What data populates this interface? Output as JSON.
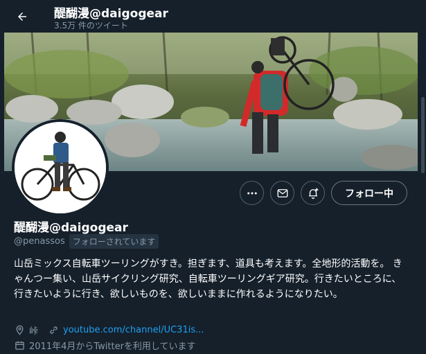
{
  "header": {
    "title": "醍醐漫@daigogear",
    "subtitle": "3.5万 件のツイート"
  },
  "profile": {
    "display_name": "醍醐漫@daigogear",
    "handle": "@penassos",
    "follows_you_badge": "フォローされています",
    "bio": "山岳ミックス自転車ツーリングがすき。担ぎます、道具も考えます。全地形的活動を。 きゃんつー集い、山岳サイクリング研究、自転車ツーリングギア研究。行きたいところに、行きたいように行き、欲しいものを、欲しいままに作れるようになりたい。",
    "location": "峠",
    "website": "youtube.com/channel/UC31is...",
    "joined": "2011年4月からTwitterを利用しています"
  },
  "actions": {
    "follow_label": "フォロー中"
  },
  "icons": {
    "back": "arrow-left-icon",
    "more": "more-dots-icon",
    "message": "envelope-icon",
    "notify": "bell-plus-icon",
    "location": "map-pin-icon",
    "link": "link-icon",
    "calendar": "calendar-icon"
  },
  "colors": {
    "background": "#15202b",
    "accent": "#1da1f2",
    "secondary_text": "#8899a6"
  }
}
